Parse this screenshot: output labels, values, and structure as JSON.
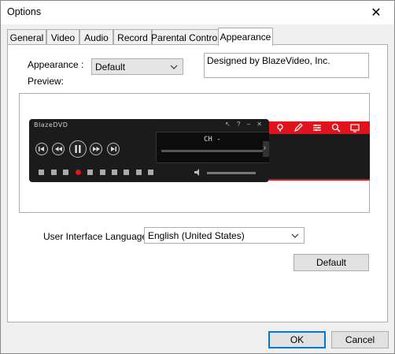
{
  "window": {
    "title": "Options",
    "close_glyph": "✕"
  },
  "tabs": [
    {
      "label": "General"
    },
    {
      "label": "Video"
    },
    {
      "label": "Audio"
    },
    {
      "label": "Record"
    },
    {
      "label": "Parental Control"
    },
    {
      "label": "Appearance",
      "active": true
    }
  ],
  "appearance": {
    "label": "Appearance :",
    "selected": "Default",
    "description": "Designed by BlazeVideo, Inc.",
    "preview_label": "Preview:"
  },
  "preview": {
    "brand": "BlazeDVD",
    "display_text": "CH -",
    "window_controls": "↖ ? – ✕",
    "side_arrow": "›"
  },
  "language": {
    "label": "User Interface Language:",
    "selected": "English (United States)"
  },
  "buttons": {
    "default": "Default",
    "ok": "OK",
    "cancel": "Cancel"
  },
  "colors": {
    "accent": "#0078d7",
    "skin_red": "#e0131c",
    "skin_dark": "#1b1b1b"
  }
}
